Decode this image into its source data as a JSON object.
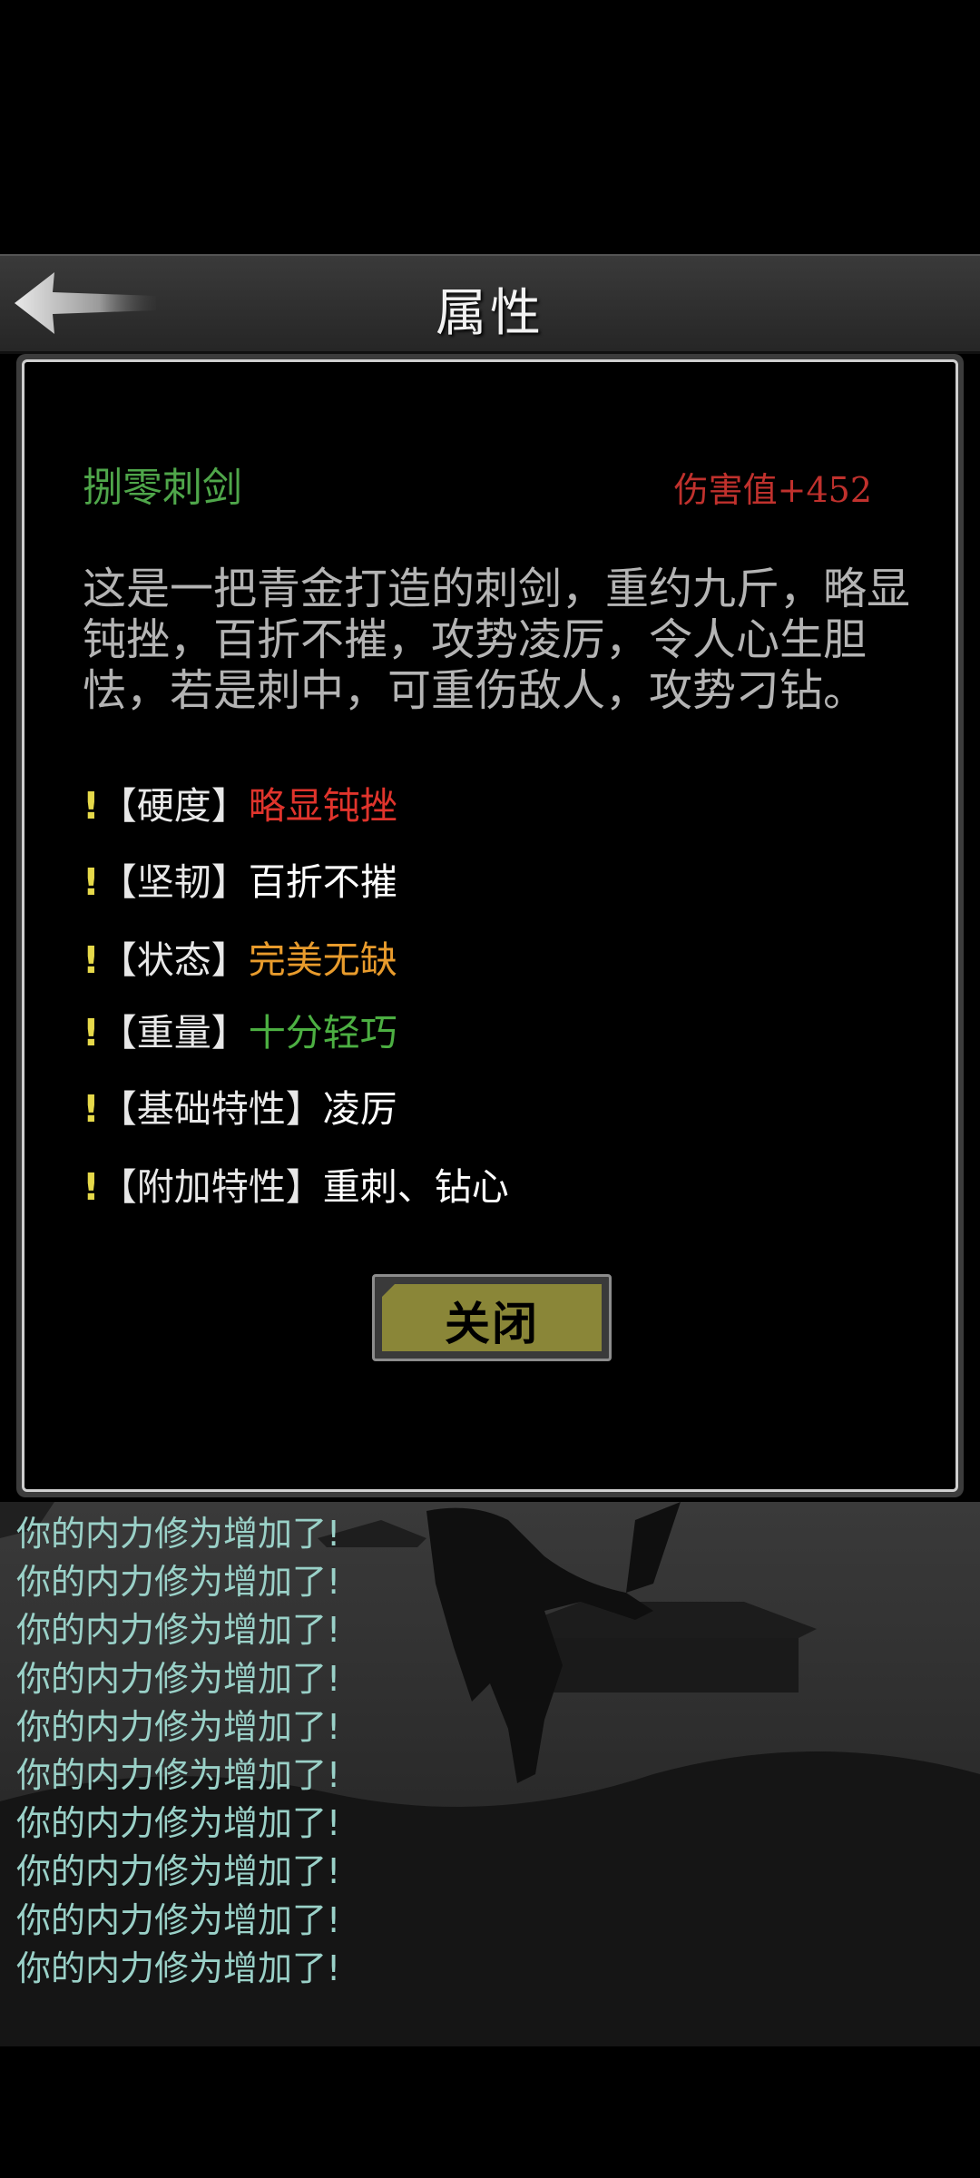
{
  "header": {
    "title": "属性",
    "back_icon": "back-arrow-icon"
  },
  "item": {
    "name": "捌零刺剑",
    "damage": "伤害值+452",
    "description": "这是一把青金打造的刺剑，重约九斤，略显钝挫，百折不摧，攻势凌厉，令人心生胆怯，若是刺中，可重伤敌人，攻势刁钻。",
    "attributes": [
      {
        "bang": "!",
        "label": "【硬度】",
        "value": "略显钝挫",
        "color": "#e0342c"
      },
      {
        "bang": "!",
        "label": "【坚韧】",
        "value": "百折不摧",
        "color": "#ffffff"
      },
      {
        "bang": "!",
        "label": "【状态】",
        "value": "完美无缺",
        "color": "#e89b2c"
      },
      {
        "bang": "!",
        "label": "【重量】",
        "value": "十分轻巧",
        "color": "#4caf42"
      },
      {
        "bang": "!",
        "label": "【基础特性】",
        "value": "凌厉",
        "color": "#ffffff"
      },
      {
        "bang": "!",
        "label": "【附加特性】",
        "value": "重刺、钻心",
        "color": "#ffffff"
      }
    ]
  },
  "dialog": {
    "close_label": "关闭"
  },
  "log": [
    "你的内力修为增加了!",
    "你的内力修为增加了!",
    "你的内力修为增加了!",
    "你的内力修为增加了!",
    "你的内力修为增加了!",
    "你的内力修为增加了!",
    "你的内力修为增加了!",
    "你的内力修为增加了!",
    "你的内力修为增加了!",
    "你的内力修为增加了!"
  ]
}
